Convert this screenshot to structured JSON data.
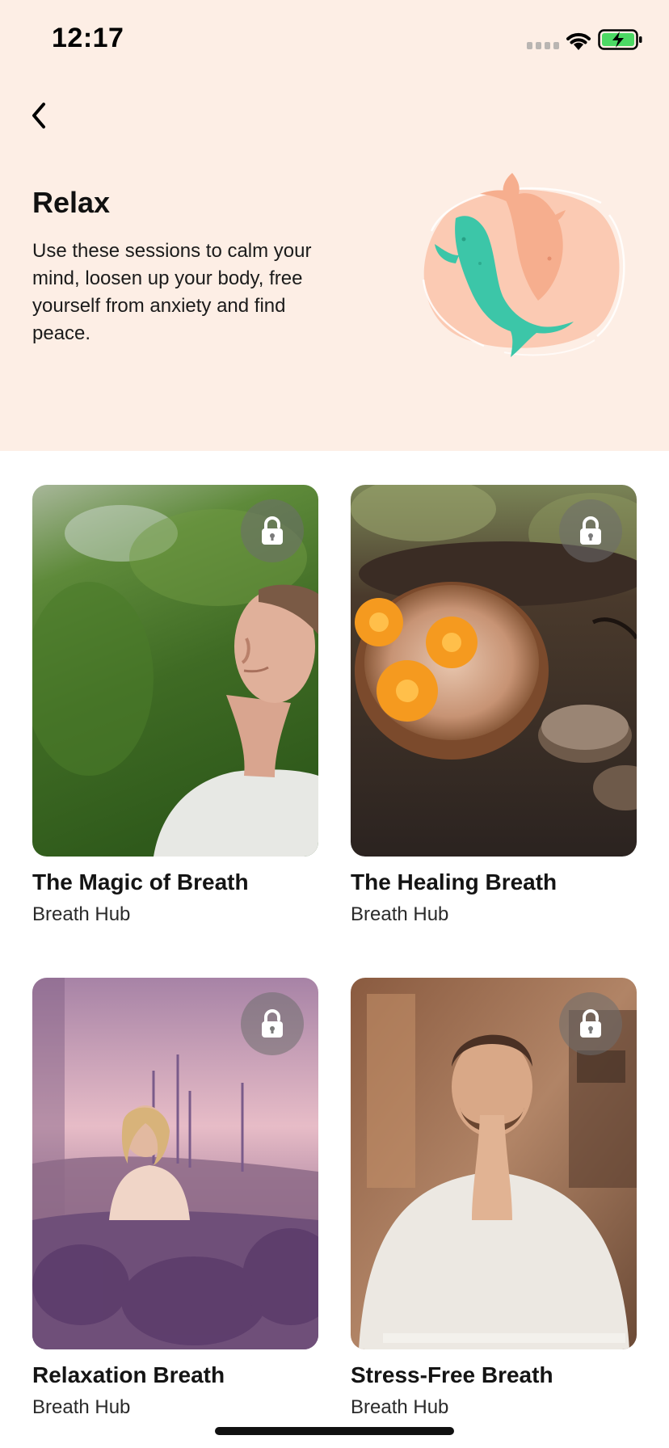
{
  "status_bar": {
    "time": "12:17"
  },
  "header": {
    "title": "Relax",
    "description": "Use these sessions to calm your mind, loosen up your body, free yourself from anxiety and find peace."
  },
  "colors": {
    "header_bg": "#fdeee5",
    "fish_teal": "#3cc6a8",
    "fish_peach": "#f6ae8e",
    "blob": "#fbc5ad"
  },
  "icons": {
    "back": "chevron-left-icon",
    "lock": "lock-icon",
    "wifi": "wifi-icon",
    "battery": "battery-charging-icon"
  },
  "sessions": [
    {
      "title": "The Magic of Breath",
      "provider": "Breath Hub",
      "locked": true
    },
    {
      "title": "The Healing Breath",
      "provider": "Breath Hub",
      "locked": true
    },
    {
      "title": "Relaxation Breath",
      "provider": "Breath Hub",
      "locked": true
    },
    {
      "title": "Stress-Free Breath",
      "provider": "Breath Hub",
      "locked": true
    }
  ]
}
